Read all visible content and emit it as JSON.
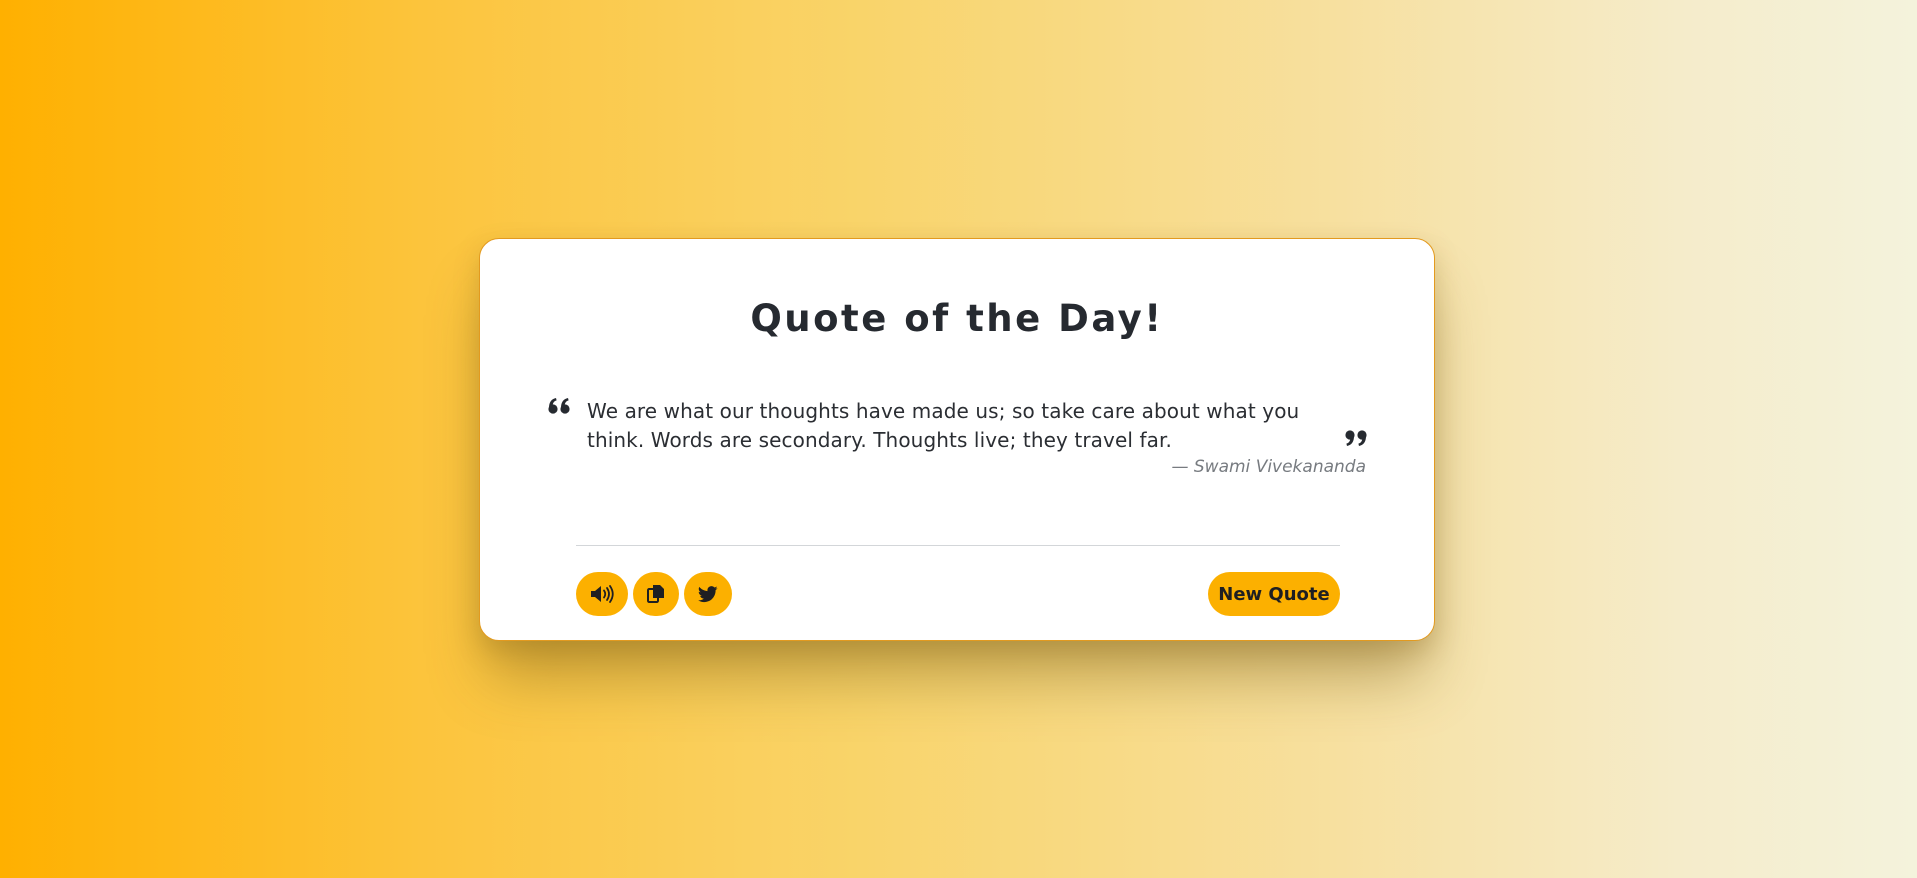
{
  "card": {
    "title": "Quote of the Day!",
    "quote": "We are what our thoughts have made us; so take care about what you think. Words are secondary. Thoughts live; they travel far.",
    "author": "— Swami Vivekananda",
    "open_quote_icon": "quote-left-icon",
    "close_quote_icon": "quote-right-icon"
  },
  "actions": {
    "speak_icon": "volume-icon",
    "copy_icon": "copy-icon",
    "tweet_icon": "twitter-icon",
    "new_quote_label": "New Quote"
  },
  "colors": {
    "accent": "#fcb000",
    "border": "#e39a1f",
    "text": "#262a30",
    "author": "#777b80",
    "gradient_start": "#ffb000",
    "gradient_end": "#f4f3dc"
  }
}
